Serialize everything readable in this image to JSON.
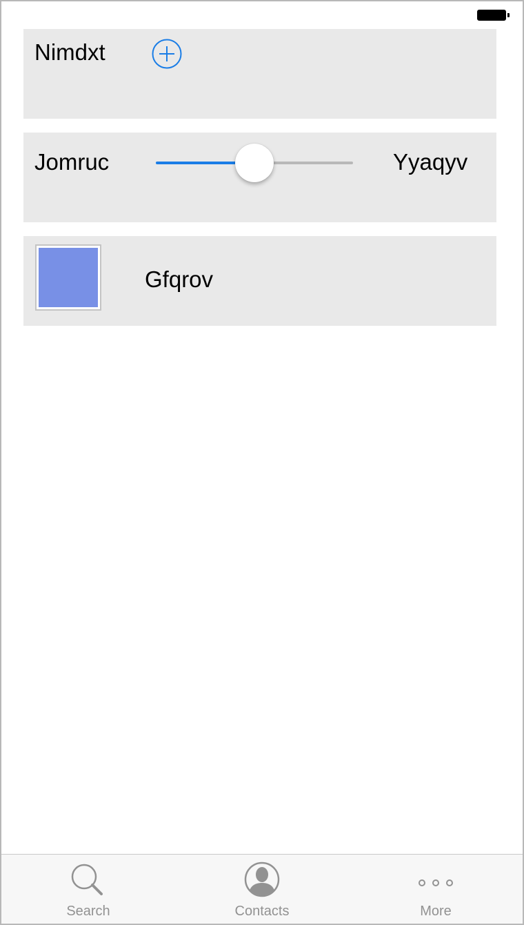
{
  "colors": {
    "cell_background": "#e9e9e9",
    "accent": "#1a7de6",
    "swatch": "#7890e6",
    "tab_inactive": "#929292"
  },
  "status_bar": {
    "battery_icon": "battery-full-icon"
  },
  "rows": {
    "stepper": {
      "label": "Nimdxt",
      "icon": "plus-circle-icon"
    },
    "slider": {
      "min_label": "Jomruc",
      "max_label": "Yyaqyv",
      "value": 0.5
    },
    "color": {
      "label": "Gfqrov",
      "swatch_color": "#7890e6"
    }
  },
  "tab_bar": {
    "tabs": [
      {
        "label": "Search",
        "icon": "search-icon"
      },
      {
        "label": "Contacts",
        "icon": "contact-person-icon"
      },
      {
        "label": "More",
        "icon": "more-dots-icon"
      }
    ]
  }
}
